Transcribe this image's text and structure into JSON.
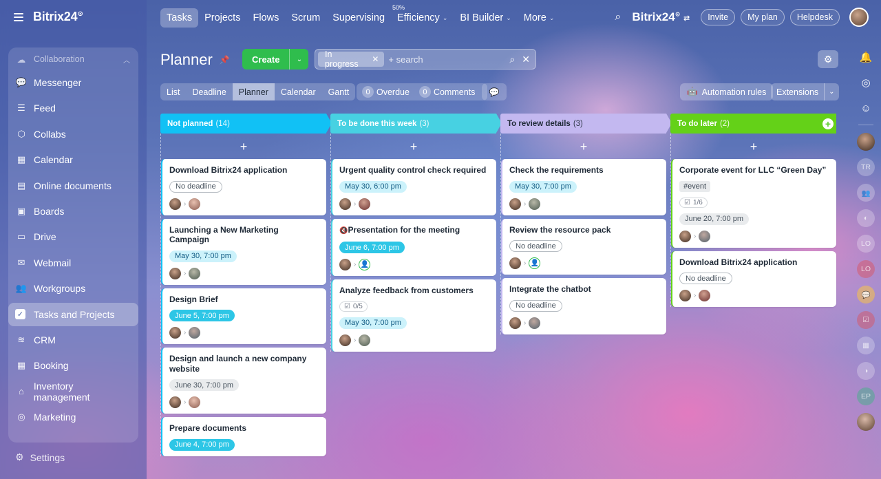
{
  "app": {
    "brand": "Bitrix24",
    "brand_mark": "⊙"
  },
  "sidebar": {
    "section": "Collaboration",
    "items": [
      {
        "label": "Messenger",
        "icon": "💬"
      },
      {
        "label": "Feed",
        "icon": "☰"
      },
      {
        "label": "Collabs",
        "icon": "⬡"
      },
      {
        "label": "Calendar",
        "icon": "▦"
      },
      {
        "label": "Online documents",
        "icon": "▤"
      },
      {
        "label": "Boards",
        "icon": "▣"
      },
      {
        "label": "Drive",
        "icon": "▭"
      },
      {
        "label": "Webmail",
        "icon": "✉"
      },
      {
        "label": "Workgroups",
        "icon": "👥"
      },
      {
        "label": "Tasks and Projects",
        "icon": "✓"
      },
      {
        "label": "CRM",
        "icon": "≋"
      },
      {
        "label": "Booking",
        "icon": "▦"
      },
      {
        "label": "Inventory management",
        "icon": "⌂"
      },
      {
        "label": "Marketing",
        "icon": "◎"
      }
    ],
    "settings": "Settings"
  },
  "topnav": {
    "tabs": [
      "Tasks",
      "Projects",
      "Flows",
      "Scrum",
      "Supervising",
      "Efficiency",
      "BI Builder",
      "More"
    ],
    "efficiency_tag": "50%"
  },
  "topright": {
    "invite": "Invite",
    "my_plan": "My plan",
    "helpdesk": "Helpdesk"
  },
  "page": {
    "title": "Planner",
    "create": "Create",
    "filter_chip": "In progress",
    "search_placeholder": "+ search"
  },
  "views": [
    "List",
    "Deadline",
    "Planner",
    "Calendar",
    "Gantt"
  ],
  "counters": {
    "overdue_count": "0",
    "overdue_label": "Overdue",
    "comments_count": "0",
    "comments_label": "Comments"
  },
  "toolbar": {
    "automation": "Automation rules",
    "extensions": "Extensions"
  },
  "colors": {
    "col1": "#11c1f5",
    "col2": "#47d1e2",
    "col3": "#c3b8f0",
    "col4": "#64d118"
  },
  "columns": [
    {
      "title": "Not planned",
      "count": "(14)",
      "cards": [
        {
          "title": "Download Bitrix24 application",
          "badge": "No deadline"
        },
        {
          "title": "Launching a New Marketing Campaign",
          "badge": "May 30, 7:00 pm"
        },
        {
          "title": "Design Brief",
          "badge": "June 5, 7:00 pm"
        },
        {
          "title": "Design and launch a new company website",
          "badge": "June 30, 7:00 pm"
        },
        {
          "title": "Prepare documents",
          "badge": "June 4, 7:00 pm"
        }
      ]
    },
    {
      "title": "To be done this week",
      "count": "(3)",
      "cards": [
        {
          "title": "Urgent quality control check required",
          "badge": "May 30, 6:00 pm"
        },
        {
          "title": "Presentation for the meeting",
          "badge": "June 6, 7:00 pm"
        },
        {
          "title": "Analyze feedback from customers",
          "check": "0/5",
          "badge": "May 30, 7:00 pm"
        }
      ]
    },
    {
      "title": "To review details",
      "count": "(3)",
      "cards": [
        {
          "title": "Check the requirements",
          "badge": "May 30, 7:00 pm"
        },
        {
          "title": "Review the resource pack",
          "badge": "No deadline"
        },
        {
          "title": "Integrate the chatbot",
          "badge": "No deadline"
        }
      ]
    },
    {
      "title": "To do later",
      "count": "(2)",
      "cards": [
        {
          "title": "Corporate event for LLC “Green Day”",
          "tag": "#event",
          "check": "1/6",
          "badge": "June 20, 7:00 pm"
        },
        {
          "title": "Download Bitrix24 application",
          "badge": "No deadline"
        }
      ]
    }
  ],
  "rail": {
    "initials_tr": "TR",
    "initials_lo1": "LO",
    "initials_lo2": "LO",
    "initials_ep": "EP"
  }
}
